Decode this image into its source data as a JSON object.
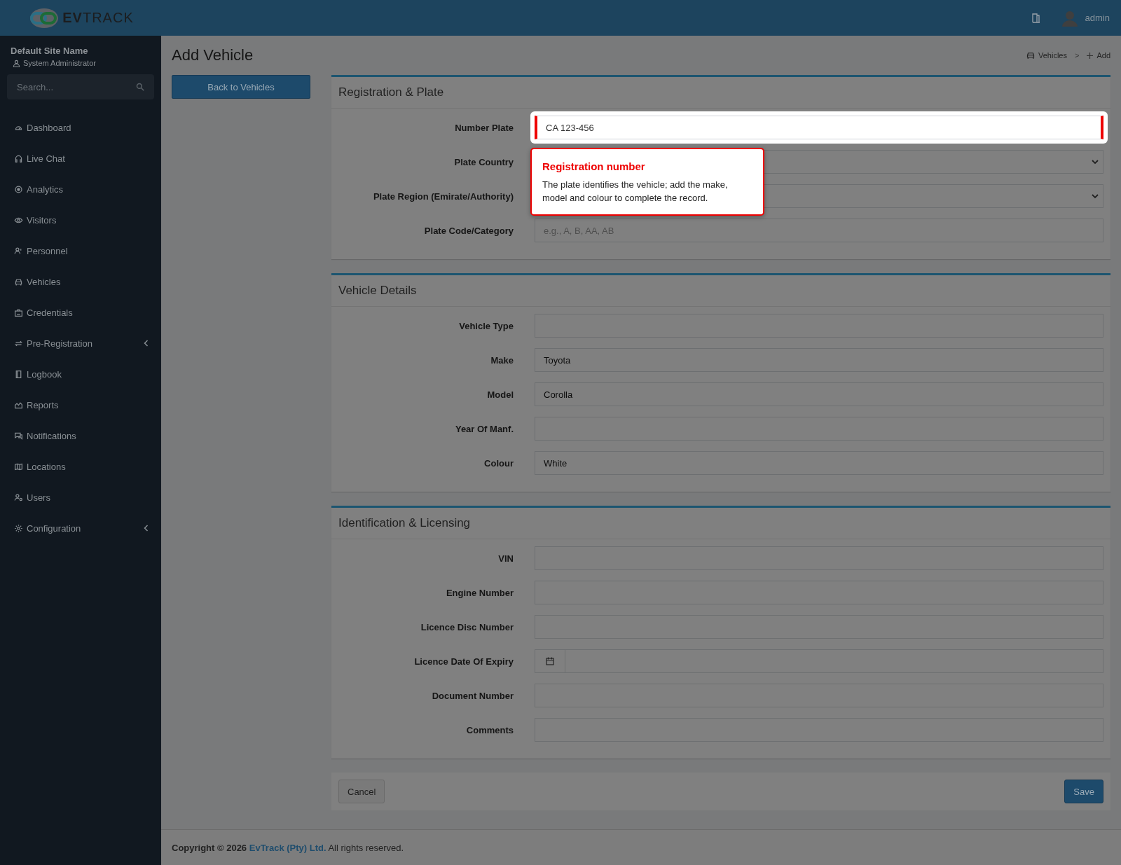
{
  "header": {
    "logo": "**EV**TRACK",
    "user": "admin"
  },
  "sidebar": {
    "site_name": "Default Site Name",
    "role": "System Administrator",
    "search": {
      "placeholder": "Search..."
    },
    "items": [
      {
        "label": "Dashboard",
        "expandable": false
      },
      {
        "label": "Live Chat",
        "expandable": false
      },
      {
        "label": "Analytics",
        "expandable": false
      },
      {
        "label": "Visitors",
        "expandable": false
      },
      {
        "label": "Personnel",
        "expandable": false
      },
      {
        "label": "Vehicles",
        "expandable": false
      },
      {
        "label": "Credentials",
        "expandable": false
      },
      {
        "label": "Pre-Registration",
        "expandable": true
      },
      {
        "label": "Logbook",
        "expandable": false
      },
      {
        "label": "Reports",
        "expandable": false
      },
      {
        "label": "Notifications",
        "expandable": false
      },
      {
        "label": "Locations",
        "expandable": false
      },
      {
        "label": "Users",
        "expandable": false
      },
      {
        "label": "Configuration",
        "expandable": true
      }
    ]
  },
  "page": {
    "title": "Add Vehicle",
    "breadcrumb": [
      "Vehicles",
      ">",
      "Add"
    ],
    "back_button": "Back to Vehicles"
  },
  "sections": [
    {
      "title": "Registration & Plate",
      "fields": [
        {
          "label": "Number Plate",
          "kind": "text",
          "value": "CA 123-456",
          "highlighted": true
        },
        {
          "label": "Plate Country",
          "kind": "select",
          "highlighted": false
        },
        {
          "label": "Plate Region (Emirate/Authority)",
          "kind": "select",
          "highlighted": false
        },
        {
          "label": "Plate Code/Category",
          "kind": "text",
          "placeholder": "e.g., A, B, AA, AB",
          "highlighted": false
        }
      ]
    },
    {
      "title": "Vehicle Details",
      "fields": [
        {
          "label": "Vehicle Type",
          "kind": "text",
          "highlighted": false
        },
        {
          "label": "Make",
          "kind": "text",
          "value": "Toyota",
          "highlighted": false
        },
        {
          "label": "Model",
          "kind": "text",
          "value": "Corolla",
          "highlighted": false
        },
        {
          "label": "Year Of Manf.",
          "kind": "text",
          "highlighted": false
        },
        {
          "label": "Colour",
          "kind": "text",
          "value": "White",
          "highlighted": false
        }
      ]
    },
    {
      "title": "Identification & Licensing",
      "fields": [
        {
          "label": "VIN",
          "kind": "text",
          "highlighted": false
        },
        {
          "label": "Engine Number",
          "kind": "text",
          "highlighted": false
        },
        {
          "label": "Licence Disc Number",
          "kind": "text",
          "highlighted": false
        },
        {
          "label": "Licence Date Of Expiry",
          "kind": "date",
          "highlighted": false
        },
        {
          "label": "Document Number",
          "kind": "text",
          "highlighted": false
        },
        {
          "label": "Comments",
          "kind": "text",
          "highlighted": false
        }
      ]
    }
  ],
  "actions": {
    "cancel": "Cancel",
    "save": "Save"
  },
  "tour": {
    "title": "Registration number",
    "text": "The plate identifies the vehicle; add the make, model and colour to complete the record."
  },
  "footer": {
    "prefix": "Copyright © 2026",
    "link": "EvTrack (Pty) Ltd.",
    "suffix": "All rights reserved."
  }
}
